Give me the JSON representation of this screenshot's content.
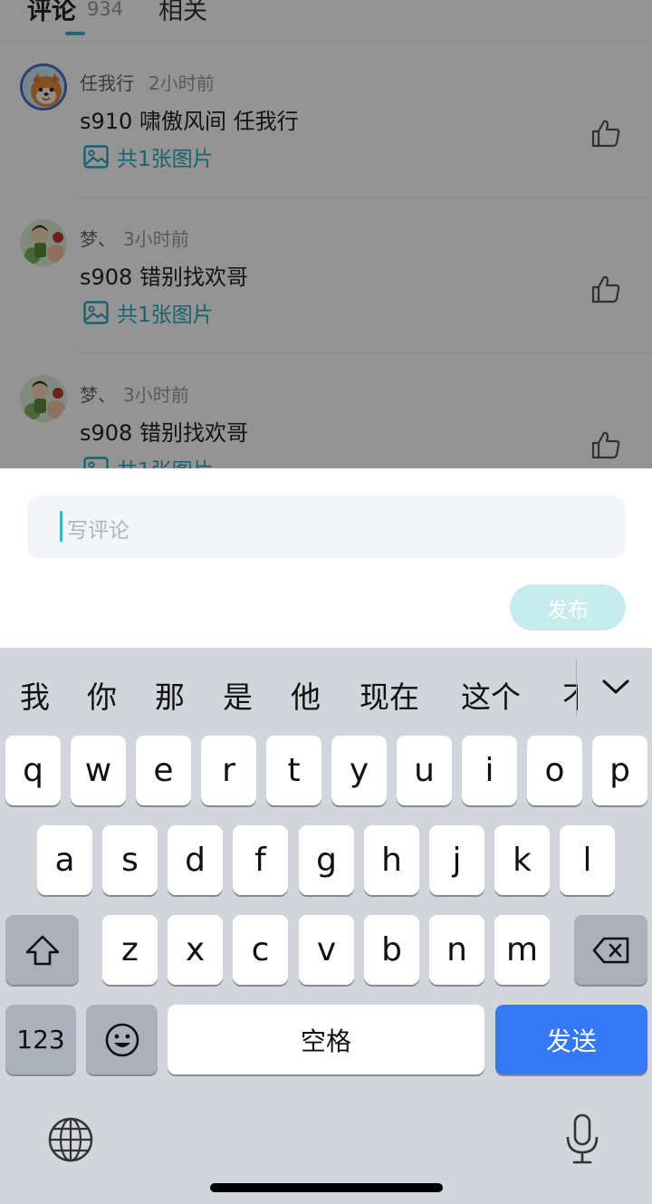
{
  "tabs": {
    "comments_label": "评论",
    "comments_count": "934",
    "related_label": "相关"
  },
  "comments": [
    {
      "user": "任我行",
      "time": "2小时前",
      "text": "s910 啸傲风间 任我行",
      "images_link": "共1张图片"
    },
    {
      "user": "梦、",
      "time": "3小时前",
      "text": "s908 错别找欢哥",
      "images_link": "共1张图片"
    },
    {
      "user": "梦、",
      "time": "3小时前",
      "text": "s908 错别找欢哥",
      "images_link": "共1张图片"
    }
  ],
  "input": {
    "placeholder": "写评论",
    "publish_label": "发布"
  },
  "keyboard": {
    "candidates": [
      "我",
      "你",
      "那",
      "是",
      "他",
      "现在",
      "这个",
      "不"
    ],
    "row1": [
      "q",
      "w",
      "e",
      "r",
      "t",
      "y",
      "u",
      "i",
      "o",
      "p"
    ],
    "row2": [
      "a",
      "s",
      "d",
      "f",
      "g",
      "h",
      "j",
      "k",
      "l"
    ],
    "row3": [
      "z",
      "x",
      "c",
      "v",
      "b",
      "n",
      "m"
    ],
    "numbers_label": "123",
    "space_label": "空格",
    "send_label": "发送"
  },
  "colors": {
    "accent": "#37b3c6",
    "send_blue": "#3478f6",
    "publish_disabled": "#c6ecef",
    "keyboard_bg": "#d2d5db"
  },
  "icons": [
    "image-icon",
    "thumbs-up-icon",
    "chevron-down-icon",
    "shift-icon",
    "backspace-icon",
    "emoji-icon",
    "globe-icon",
    "microphone-icon"
  ]
}
